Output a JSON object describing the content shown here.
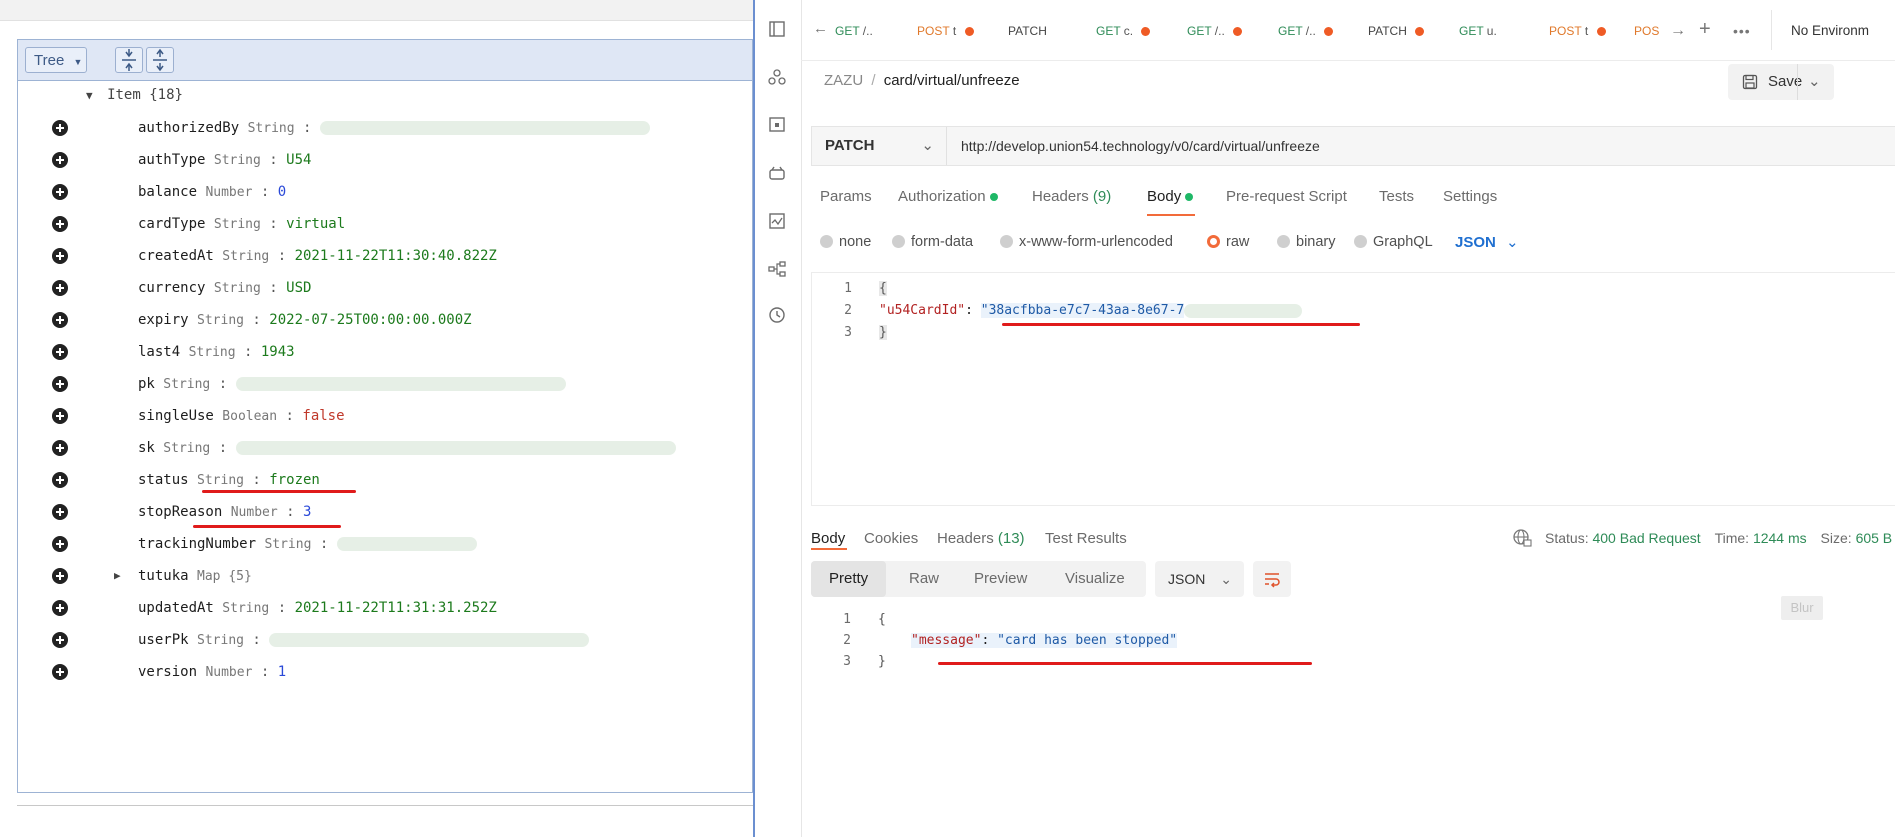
{
  "tree": {
    "mode_label": "Tree",
    "root_label": "Item {18}",
    "rows": [
      {
        "key": "authorizedBy",
        "type": "String",
        "value": "",
        "kind": "str"
      },
      {
        "key": "authType",
        "type": "String",
        "value": "U54",
        "kind": "str"
      },
      {
        "key": "balance",
        "type": "Number",
        "value": "0",
        "kind": "num"
      },
      {
        "key": "cardType",
        "type": "String",
        "value": "virtual",
        "kind": "str"
      },
      {
        "key": "createdAt",
        "type": "String",
        "value": "2021-11-22T11:30:40.822Z",
        "kind": "str"
      },
      {
        "key": "currency",
        "type": "String",
        "value": "USD",
        "kind": "str"
      },
      {
        "key": "expiry",
        "type": "String",
        "value": "2022-07-25T00:00:00.000Z",
        "kind": "str"
      },
      {
        "key": "last4",
        "type": "String",
        "value": "1943",
        "kind": "str"
      },
      {
        "key": "pk",
        "type": "String",
        "value": "",
        "kind": "str"
      },
      {
        "key": "singleUse",
        "type": "Boolean",
        "value": "false",
        "kind": "bool"
      },
      {
        "key": "sk",
        "type": "String",
        "value": "",
        "kind": "str"
      },
      {
        "key": "status",
        "type": "String",
        "value": "frozen",
        "kind": "str"
      },
      {
        "key": "stopReason",
        "type": "Number",
        "value": "3",
        "kind": "num"
      },
      {
        "key": "trackingNumber",
        "type": "String",
        "value": "",
        "kind": "str"
      },
      {
        "key": "tutuka",
        "type": "Map {5}",
        "value": "",
        "kind": "map"
      },
      {
        "key": "updatedAt",
        "type": "String",
        "value": "2021-11-22T11:31:31.252Z",
        "kind": "str"
      },
      {
        "key": "userPk",
        "type": "String",
        "value": "",
        "kind": "str"
      },
      {
        "key": "version",
        "type": "Number",
        "value": "1",
        "kind": "num"
      }
    ]
  },
  "postman": {
    "tabs": [
      {
        "method": "GET",
        "name": "/.."
      },
      {
        "method": "POST",
        "name": "t"
      },
      {
        "method": "PATCH",
        "name": ""
      },
      {
        "method": "GET",
        "name": "c."
      },
      {
        "method": "GET",
        "name": "/.."
      },
      {
        "method": "GET",
        "name": "/.."
      },
      {
        "method": "PATCH",
        "name": ""
      },
      {
        "method": "GET",
        "name": "u."
      },
      {
        "method": "POST",
        "name": "t"
      },
      {
        "method": "POS",
        "name": ""
      }
    ],
    "environment": "No Environm",
    "breadcrumb_collection": "ZAZU",
    "breadcrumb_sep": "/",
    "breadcrumb_request": "card/virtual/unfreeze",
    "save_label": "Save",
    "method": "PATCH",
    "url": "http://develop.union54.technology/v0/card/virtual/unfreeze",
    "request_tabs": {
      "params": "Params",
      "authorization": "Authorization",
      "headers": "Headers",
      "headers_count": "(9)",
      "body": "Body",
      "prerequest": "Pre-request Script",
      "tests": "Tests",
      "settings": "Settings"
    },
    "body_options": [
      "none",
      "form-data",
      "x-www-form-urlencoded",
      "raw",
      "binary",
      "GraphQL"
    ],
    "body_format": "JSON",
    "request_body": {
      "line_numbers": [
        "1",
        "2",
        "3"
      ],
      "key": "\"u54CardId\"",
      "colon": ":",
      "value": "\"38acfbba-e7c7-43aa-8e67-7",
      "open": "{",
      "close": "}"
    },
    "response_tabs": {
      "body": "Body",
      "cookies": "Cookies",
      "headers": "Headers",
      "headers_count": "(13)",
      "test_results": "Test Results"
    },
    "status_label": "Status:",
    "status_value": "400 Bad Request",
    "time_label": "Time:",
    "time_value": "1244 ms",
    "size_label": "Size:",
    "size_value": "605 B",
    "view_tabs": [
      "Pretty",
      "Raw",
      "Preview",
      "Visualize"
    ],
    "response_format": "JSON",
    "blur_label": "Blur",
    "response_body": {
      "line_numbers": [
        "1",
        "2",
        "3"
      ],
      "open": "{",
      "key": "\"message\"",
      "colon": ":",
      "value": "\"card has been stopped\"",
      "close": "}"
    }
  }
}
